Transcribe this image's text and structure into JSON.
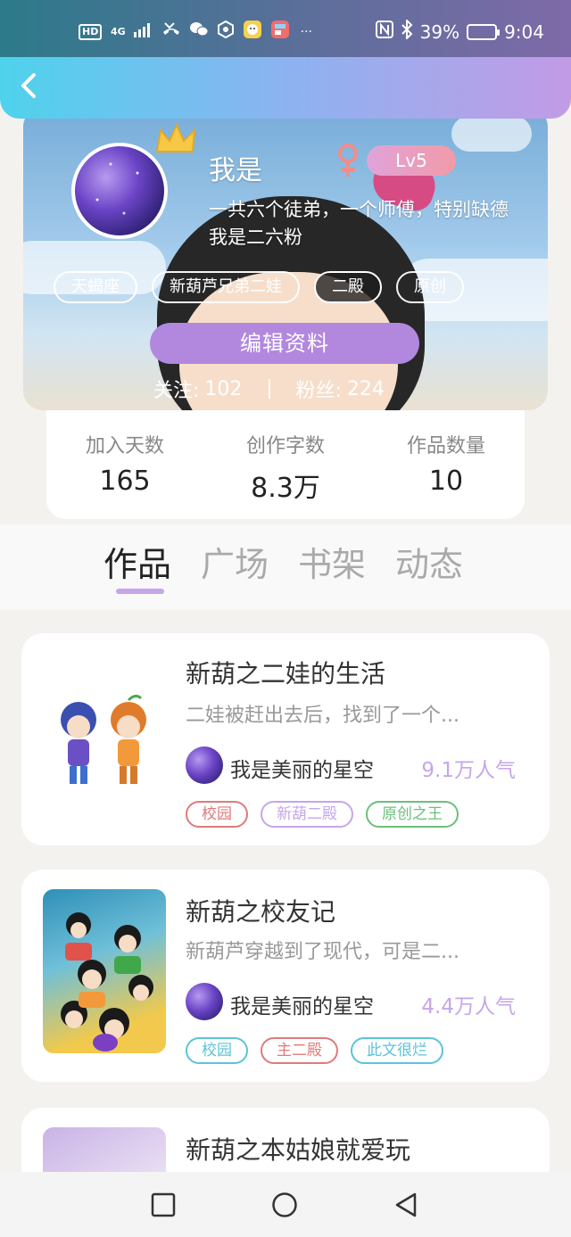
{
  "status_bar": {
    "network": "4G",
    "battery": "39%",
    "time": "9:04",
    "left_icons": [
      "hd-icon",
      "signal-icon",
      "missed-call-icon",
      "wechat-icon",
      "app-icon",
      "qq-icon",
      "app-icon",
      "more-dots-icon"
    ],
    "right_icons": [
      "nfc-icon",
      "bluetooth-icon",
      "battery-icon"
    ]
  },
  "header": {
    "back_icon": "chevron-left-icon"
  },
  "profile": {
    "username": "我是",
    "gender": "female",
    "level": "Lv5",
    "bio_line1": "一共六个徒弟，一个师傅，特别缺德",
    "bio_line2": "我是二六粉",
    "tags": [
      "天蝎座",
      "新葫芦兄弟二娃",
      "二殿",
      "原创"
    ],
    "active_tag_index": 2,
    "edit_button": "编辑资料",
    "following_label": "关注:",
    "following_count": "102",
    "followers_label": "粉丝:",
    "followers_count": "224"
  },
  "stats": [
    {
      "label": "加入天数",
      "value": "165"
    },
    {
      "label": "创作字数",
      "value": "8.3万"
    },
    {
      "label": "作品数量",
      "value": "10"
    }
  ],
  "tabs": [
    {
      "label": "作品",
      "active": true
    },
    {
      "label": "广场",
      "active": false
    },
    {
      "label": "书架",
      "active": false
    },
    {
      "label": "动态",
      "active": false
    }
  ],
  "works": [
    {
      "title": "新葫之二娃的生活",
      "desc": "二娃被赶出去后，找到了一个...",
      "author": "我是美丽的星空",
      "popularity": "9.1万人气",
      "tags": [
        {
          "label": "校园",
          "color": "#e07a7a"
        },
        {
          "label": "新葫二殿",
          "color": "#c6a6ea"
        },
        {
          "label": "原创之王",
          "color": "#6cbf7a"
        }
      ]
    },
    {
      "title": "新葫之校友记",
      "desc": "新葫芦穿越到了现代，可是二...",
      "author": "我是美丽的星空",
      "popularity": "4.4万人气",
      "tags": [
        {
          "label": "校园",
          "color": "#5bc4d8"
        },
        {
          "label": "主二殿",
          "color": "#e07a7a"
        },
        {
          "label": "此文很烂",
          "color": "#5bc4d8"
        }
      ]
    },
    {
      "title": "新葫之本姑娘就爱玩"
    }
  ],
  "nav": {
    "icons": [
      "recents-square-icon",
      "home-circle-icon",
      "back-triangle-icon"
    ]
  }
}
